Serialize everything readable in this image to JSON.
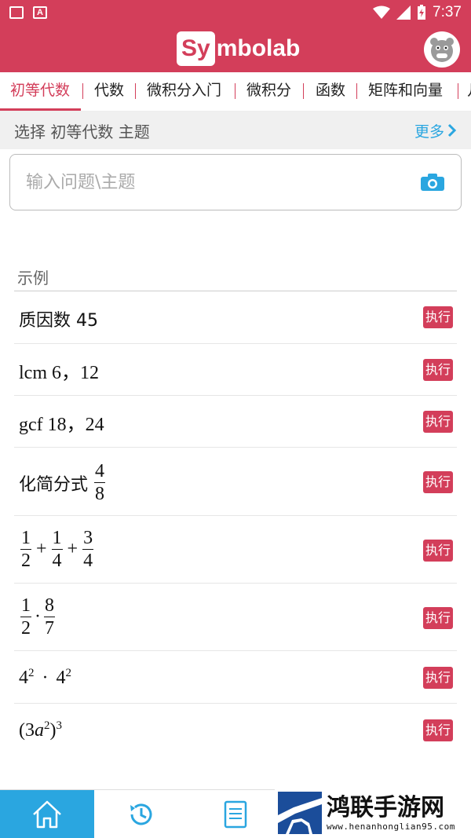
{
  "status": {
    "time": "7:37"
  },
  "app": {
    "logo_box": "Sy",
    "logo_rest": "mbolab"
  },
  "tabs": [
    {
      "label": "初等代数"
    },
    {
      "label": "代数"
    },
    {
      "label": "微积分入门"
    },
    {
      "label": "微积分"
    },
    {
      "label": "函数"
    },
    {
      "label": "矩阵和向量"
    },
    {
      "label": "几"
    }
  ],
  "topic": {
    "title": "选择 初等代数 主题",
    "more": "更多"
  },
  "search": {
    "placeholder": "输入问题\\主题"
  },
  "examples": {
    "label": "示例",
    "run_label": "执行",
    "items": [
      {
        "text": "质因数 45"
      },
      {
        "text": "lcm 6，12"
      },
      {
        "text": "gcf 18，24"
      },
      {
        "prefix": "化简分式",
        "num": "4",
        "den": "8"
      },
      {
        "f1n": "1",
        "f1d": "2",
        "f2n": "1",
        "f2d": "4",
        "f3n": "3",
        "f3d": "4"
      },
      {
        "f1n": "1",
        "f1d": "2",
        "f2n": "8",
        "f2d": "7"
      },
      {
        "base1": "4",
        "exp1": "2",
        "base2": "4",
        "exp2": "2"
      },
      {
        "open": "(3",
        "var": "a",
        "exp_in": "2",
        "close": ")",
        "exp_out": "3"
      }
    ]
  },
  "watermark": {
    "cn": "鸿联手游网",
    "url": "www.henanhonglian95.com"
  },
  "colors": {
    "brand": "#d33e5a",
    "accent": "#2aa6e0"
  }
}
